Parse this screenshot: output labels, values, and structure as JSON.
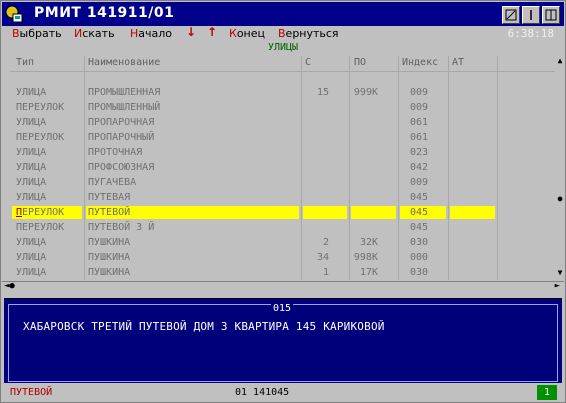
{
  "window": {
    "title": "РМИТ 141911/01",
    "clock": "6:38:18"
  },
  "menu": [
    {
      "hk": "В",
      "rest": "ыбрать"
    },
    {
      "hk": "И",
      "rest": "скать"
    },
    {
      "hk": "Н",
      "rest": "ачало"
    },
    {
      "arrow": "↓"
    },
    {
      "arrow": "↑"
    },
    {
      "hk": "К",
      "rest": "онец"
    },
    {
      "hk": "В",
      "rest": "ернуться"
    }
  ],
  "caption": "УЛИЦЫ",
  "table": {
    "headers": [
      "Тип",
      "Наименование",
      "С",
      "ПО",
      "Индекс",
      "АТ"
    ],
    "rows": [
      {
        "type": "УЛИЦА",
        "name": "ПРОМЫШЛЕННАЯ",
        "from": "15",
        "to": "999К",
        "index": "009"
      },
      {
        "type": "ПЕРЕУЛОК",
        "name": "ПРОМЫШЛЕННЫЙ",
        "from": "",
        "to": "",
        "index": "009"
      },
      {
        "type": "УЛИЦА",
        "name": "ПРОПАРОЧНАЯ",
        "from": "",
        "to": "",
        "index": "061"
      },
      {
        "type": "ПЕРЕУЛОК",
        "name": "ПРОПАРОЧНЫЙ",
        "from": "",
        "to": "",
        "index": "061"
      },
      {
        "type": "УЛИЦА",
        "name": "ПРОТОЧНАЯ",
        "from": "",
        "to": "",
        "index": "023"
      },
      {
        "type": "УЛИЦА",
        "name": "ПРОФСОЮЗНАЯ",
        "from": "",
        "to": "",
        "index": "042"
      },
      {
        "type": "УЛИЦА",
        "name": "ПУГАЧЕВА",
        "from": "",
        "to": "",
        "index": "009"
      },
      {
        "type": "УЛИЦА",
        "name": "ПУТЕВАЯ",
        "from": "",
        "to": "",
        "index": "045"
      },
      {
        "type": "ПЕРЕУЛОК",
        "name": "ПУТЕВОЙ",
        "from": "",
        "to": "",
        "index": "045",
        "selected": true
      },
      {
        "type": "ПЕРЕУЛОК",
        "name": "ПУТЕВОЙ 3 Й",
        "from": "",
        "to": "",
        "index": "045"
      },
      {
        "type": "УЛИЦА",
        "name": "ПУШКИНА",
        "from": "2",
        "to": "32К",
        "index": "030"
      },
      {
        "type": "УЛИЦА",
        "name": "ПУШКИНА",
        "from": "34",
        "to": "998К",
        "index": "000"
      },
      {
        "type": "УЛИЦА",
        "name": "ПУШКИНА",
        "from": "1",
        "to": "17К",
        "index": "030"
      }
    ]
  },
  "panel": {
    "number": "015",
    "text": "ХАБАРОВСК ТРЕТИЙ ПУТЕВОЙ ДОМ 3 КВАРТИРА 145 КАРИКОВОЙ"
  },
  "status": {
    "left": "ПУТЕВОЙ",
    "middle": "01 141045",
    "badge": "1"
  }
}
